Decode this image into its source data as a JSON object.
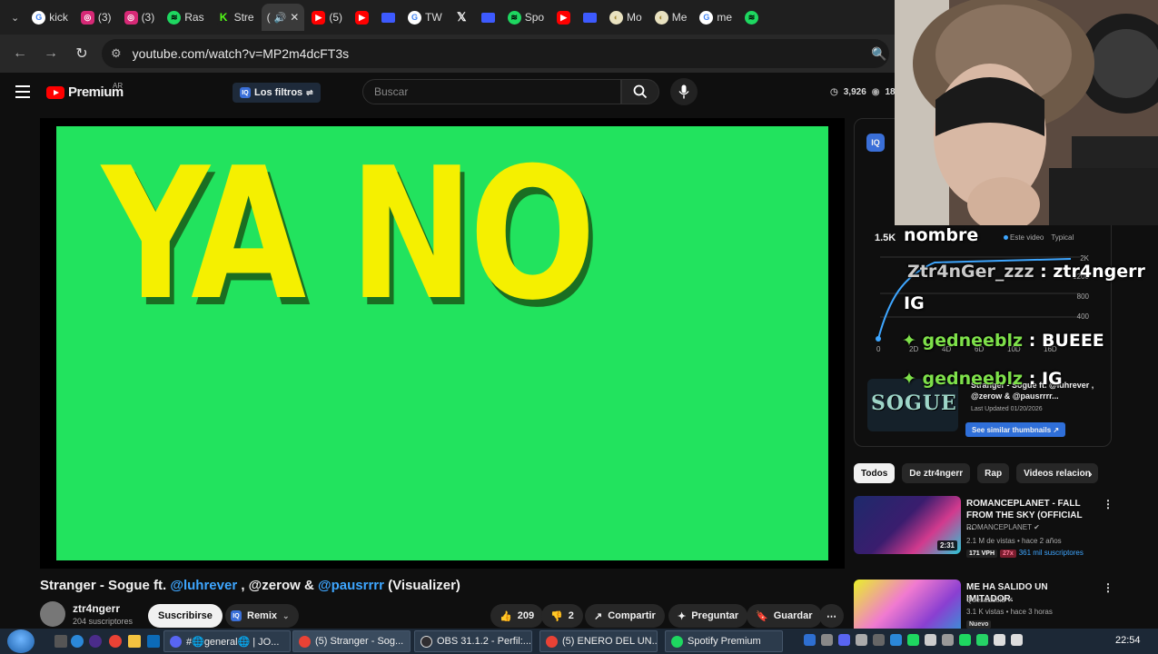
{
  "browser": {
    "tabs": [
      {
        "icon": "google-icon",
        "label": "kick"
      },
      {
        "icon": "instagram-icon",
        "label": "(3)"
      },
      {
        "icon": "instagram-icon",
        "label": "(3)"
      },
      {
        "icon": "spotify-icon",
        "label": "Ras"
      },
      {
        "icon": "kick-icon",
        "label": "Stre"
      },
      {
        "icon": "speaker-icon",
        "label": "(",
        "active": true
      },
      {
        "icon": "youtube-icon",
        "label": "(5)"
      },
      {
        "icon": "youtube-icon",
        "label": ""
      },
      {
        "icon": "monitor-icon",
        "label": ""
      },
      {
        "icon": "google-icon",
        "label": "TW"
      },
      {
        "icon": "x-icon",
        "label": ""
      },
      {
        "icon": "monitor-icon",
        "label": ""
      },
      {
        "icon": "spotify-icon",
        "label": "Spo"
      },
      {
        "icon": "youtube-icon",
        "label": ""
      },
      {
        "icon": "monitor-icon",
        "label": ""
      },
      {
        "icon": "moon-icon",
        "label": "Mo"
      },
      {
        "icon": "moon-icon",
        "label": "Me"
      },
      {
        "icon": "google-icon",
        "label": "me"
      },
      {
        "icon": "spotify-icon",
        "label": ""
      }
    ],
    "url": "youtube.com/watch?v=MP2m4dcFT3s"
  },
  "youtube": {
    "brand": "Premium",
    "country": "AR",
    "filters_label": "Los filtros",
    "search_placeholder": "Buscar",
    "stats": {
      "views": "3,926",
      "viewers": "18"
    }
  },
  "video": {
    "overlay_text": "YA NO",
    "title_prefix": "Stranger - Sogue ft. ",
    "mention1": "@luhrever",
    "title_mid": " , @zerow & ",
    "mention2": "@pausrrrr",
    "title_suffix": " (Visualizer)",
    "channel_name": "ztr4ngerr",
    "channel_subs": "204 suscriptores",
    "subscribe_label": "Suscribirse",
    "remix_label": "Remix",
    "likes": "209",
    "dislikes": "2",
    "share_label": "Compartir",
    "ask_label": "Preguntar",
    "save_label": "Guardar"
  },
  "iq_panel": {
    "metric": "1.5K",
    "legend_this": "Este video",
    "legend_typical": "Typical",
    "y_ticks": [
      "2K",
      "1200",
      "800",
      "400"
    ],
    "x_ticks": [
      "0",
      "2D",
      "4D",
      "6D",
      "10D",
      "16D"
    ],
    "card_title": "Stranger - Sogue ft. @luhrever , @zerow & @pausrrrr...",
    "card_updated": "Last Updated 01/20/2026",
    "card_thumb_text": "SOGUE",
    "similar_label": "See similar thumbnails ↗"
  },
  "chips": [
    "Todos",
    "De ztr4ngerr",
    "Rap",
    "Videos relacion"
  ],
  "recommendations": [
    {
      "title": "ROMANCEPLANET - FALL FROM THE SKY (OFFICIAL ...",
      "channel": "ROMANCEPLANET",
      "meta": "2.1 M de vistas • hace 2 años",
      "vph": "171 VPH",
      "multiplier": "27x",
      "subs": "361 mil suscriptores",
      "duration": "2:31"
    },
    {
      "title": "ME HA SALIDO UN IMITADOR.",
      "channel": "Quesadacid",
      "meta": "3.1 K vistas • hace 3 horas",
      "badge": "Nuevo"
    }
  ],
  "stream_chat": {
    "header": "nombre",
    "lines": [
      {
        "user": "Ztr4nGer_zzz",
        "msg": "ztr4ngerr",
        "cont": "IG"
      },
      {
        "user": "gedneeblz",
        "msg": "BUEEE"
      },
      {
        "user": "gedneeblz",
        "msg": "IG"
      }
    ]
  },
  "taskbar": {
    "tasks": [
      "#🌐general🌐 | JO...",
      "(5) Stranger - Sog...",
      "OBS 31.1.2 - Perfil:...",
      "(5) ENERO DEL UN...",
      "Spotify Premium"
    ],
    "clock": "22:54"
  },
  "colors": {
    "greenscreen": "#22e35e",
    "overlay_text": "#f5f000",
    "yt_red": "#ff0000",
    "link": "#3ea6ff"
  }
}
